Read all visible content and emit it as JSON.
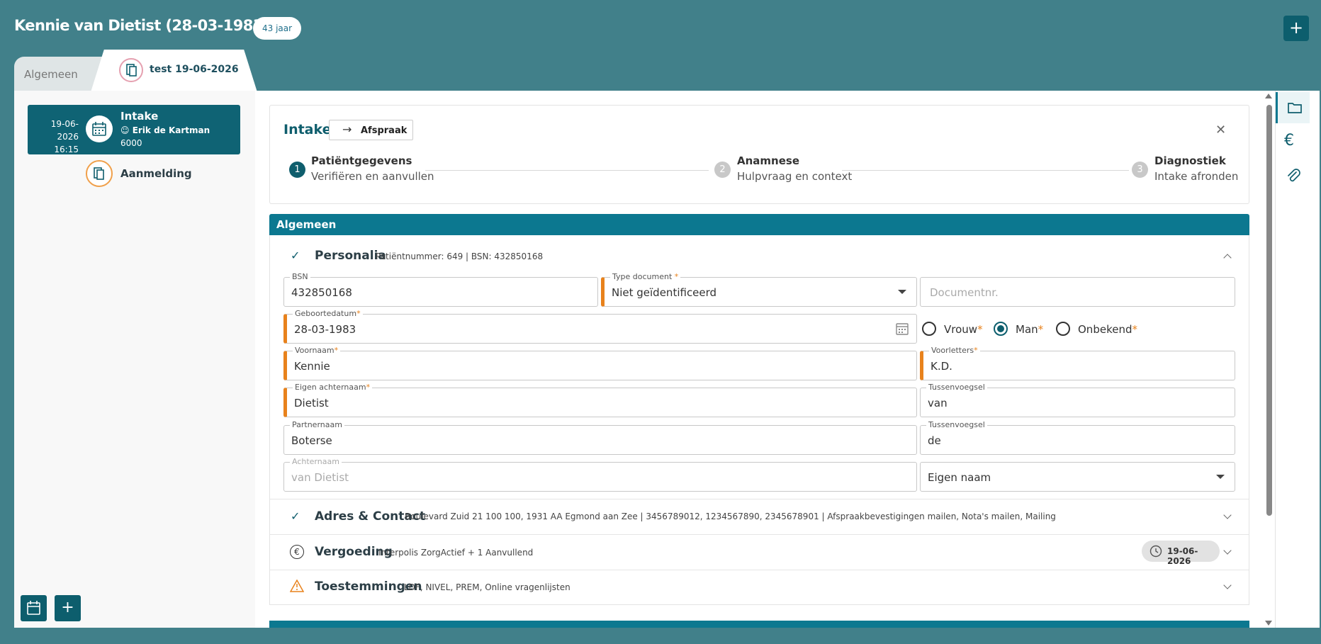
{
  "header": {
    "title": "Kennie van Dietist (28-03-1983) M",
    "age_badge": "43 jaar",
    "add_label": "+"
  },
  "tabs": [
    {
      "label": "Algemeen"
    },
    {
      "label": "test  19-06-2026"
    }
  ],
  "sidebar": {
    "appointment": {
      "date": "19-06-2026",
      "time": "16:15",
      "title": "Intake",
      "person": "Erik de Kartman",
      "code": "6000"
    },
    "aanmelding_label": "Aanmelding",
    "add_label": "+"
  },
  "intake": {
    "title": "Intake",
    "afspraak_label": "Afspraak",
    "steps": [
      {
        "num": "1",
        "title": "Patiëntgegevens",
        "sub": "Verifiëren en aanvullen"
      },
      {
        "num": "2",
        "title": "Anamnese",
        "sub": "Hulpvraag en context"
      },
      {
        "num": "3",
        "title": "Diagnostiek",
        "sub": "Intake afronden"
      }
    ]
  },
  "section": {
    "header": "Algemeen",
    "personalia": {
      "title": "Personalia",
      "sub": "Patiëntnummer: 649 | BSN: 432850168"
    },
    "fields": {
      "bsn_label": "BSN",
      "bsn": "432850168",
      "type_doc_label": "Type document",
      "type_doc": "Niet geïdentificeerd",
      "docnr_placeholder": "Documentnr.",
      "geboortedatum_label": "Geboortedatum",
      "geboortedatum": "28-03-1983",
      "voornaam_label": "Voornaam",
      "voornaam": "Kennie",
      "voorletters_label": "Voorletters",
      "voorletters": "K.D.",
      "eigen_achternaam_label": "Eigen achternaam",
      "eigen_achternaam": "Dietist",
      "tussenvoegsel_label": "Tussenvoegsel",
      "tussenvoegsel": "van",
      "partnernaam_label": "Partnernaam",
      "partnernaam": "Boterse",
      "tussenvoegsel2_label": "Tussenvoegsel",
      "tussenvoegsel2": "de",
      "achternaam_label": "Achternaam",
      "achternaam": "van Dietist",
      "naamgebruik": "Eigen naam",
      "required_mark": "*"
    },
    "gender": {
      "vrouw": "Vrouw",
      "man": "Man",
      "onbekend": "Onbekend",
      "selected": "Man"
    },
    "adres": {
      "title": "Adres & Contact",
      "sub": "Boulevard Zuid 21 100 100, 1931 AA Egmond aan Zee | 3456789012, 1234567890, 2345678901 | Afspraakbevestigingen mailen, Nota's mailen, Mailing"
    },
    "vergoeding": {
      "title": "Vergoeding",
      "sub": "Interpolis ZorgActief + 1 Aanvullend",
      "date": "19-06-2026"
    },
    "toestemmingen": {
      "title": "Toestemmingen",
      "sub": "LDF, NIVEL, PREM, Online vragenlijsten"
    }
  },
  "colors": {
    "background": "#41808a",
    "primary": "#0f6374",
    "section_header": "#0c7890",
    "required": "#e8821c"
  }
}
